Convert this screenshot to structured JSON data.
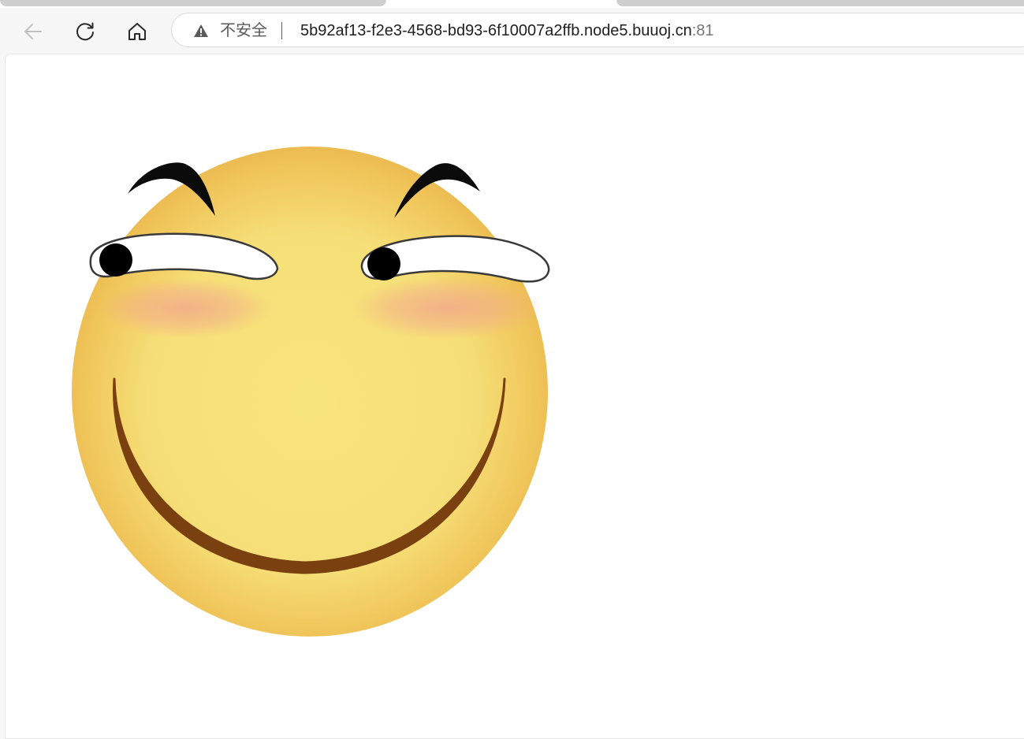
{
  "browser": {
    "security_label": "不安全",
    "url_host": "5b92af13-f2e3-4568-bd93-6f10007a2ffb.node5.buuoj.cn",
    "url_port": ":81",
    "icons": {
      "back": "back-arrow-icon",
      "reload": "reload-icon",
      "home": "home-icon",
      "warning": "warning-triangle-icon"
    }
  },
  "page": {
    "image": "smiley-face-emoji",
    "colors": {
      "face_light": "#f7e27a",
      "face_dark": "#eab84c",
      "blush": "#f2a88a",
      "mouth": "#7a4010",
      "pupil": "#000000"
    }
  }
}
